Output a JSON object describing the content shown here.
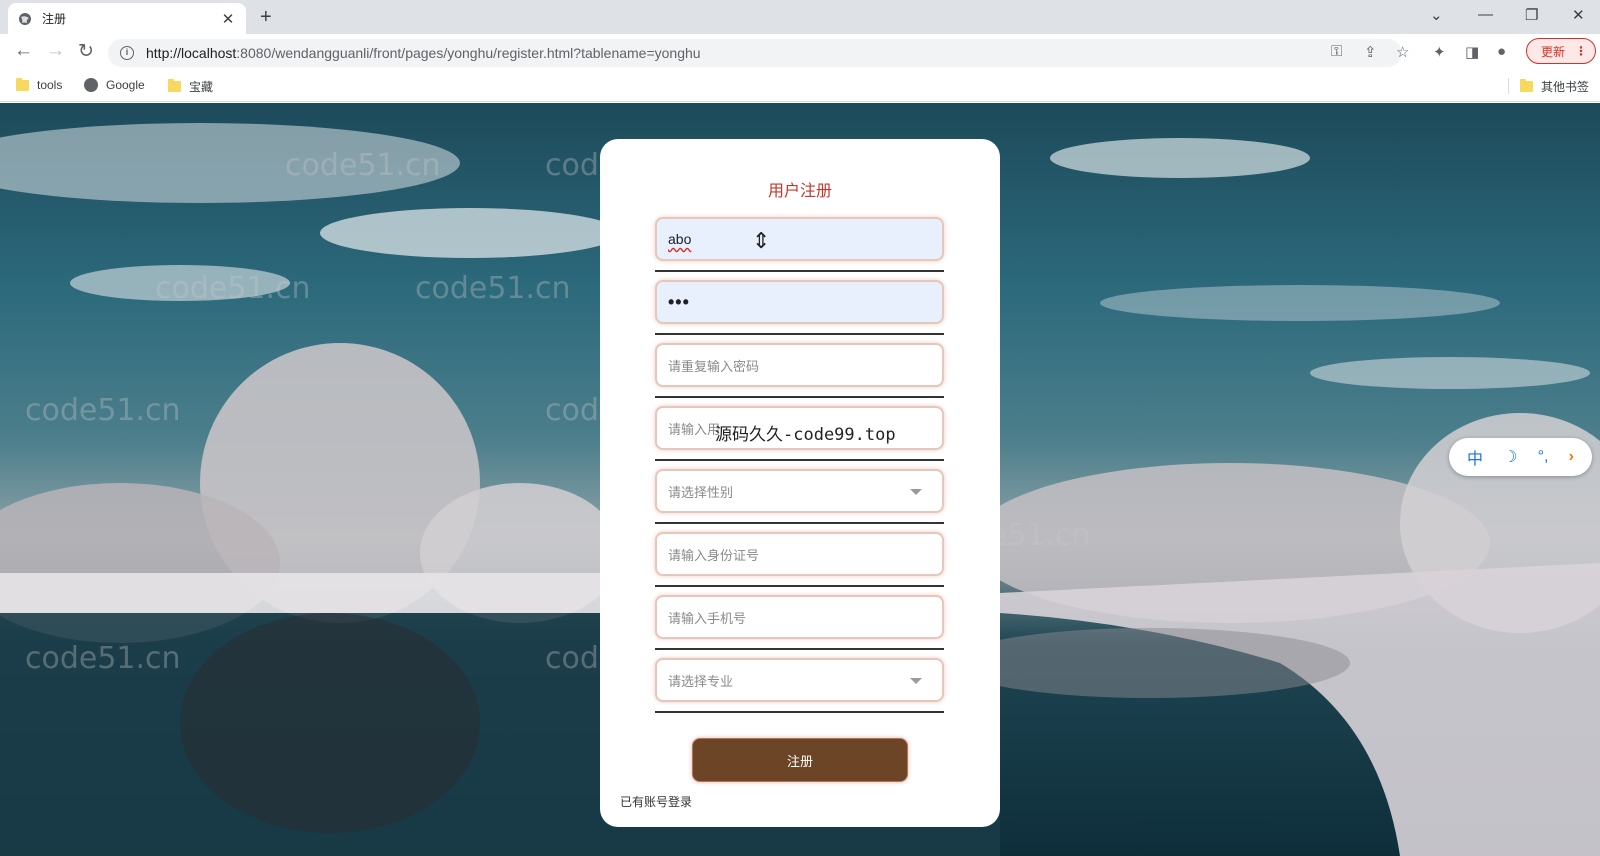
{
  "browser": {
    "tab_title": "注册",
    "tab_close": "✕",
    "new_tab": "+",
    "url_host": "http://localhost",
    "url_rest": ":8080/wendangguanli/front/pages/yonghu/register.html?tablename=yonghu",
    "update_label": "更新",
    "update_menu": "⋮",
    "bookmarks": [
      "tools",
      "Google",
      "宝藏"
    ],
    "other_bookmarks": "其他书签"
  },
  "watermark_text": "code51.cn",
  "form": {
    "title": "用户注册",
    "username_value": "abo",
    "password_value": "•••",
    "repeat_password_placeholder": "请重复输入密码",
    "name_placeholder": "请输入用",
    "gender_placeholder": "请选择性别",
    "id_number_placeholder": "请输入身份证号",
    "phone_placeholder": "请输入手机号",
    "major_placeholder": "请选择专业",
    "submit_label": "注册",
    "login_link": "已有账号登录"
  },
  "overlay_text": "源码久久-code99.top",
  "ime": {
    "mode": "中",
    "moon": "☽",
    "punct": "°,",
    "arrow": "›"
  },
  "colors": {
    "title": "#c0392b",
    "button": "#6b4525",
    "field_border": "#e7c7b9"
  },
  "icons": {
    "back": "back-arrow-icon",
    "forward": "forward-arrow-icon",
    "reload": "reload-icon",
    "key": "key-icon",
    "share": "share-icon",
    "star": "star-icon",
    "extensions": "puzzle-icon",
    "sidebar": "sidebar-icon",
    "profile": "profile-icon"
  }
}
